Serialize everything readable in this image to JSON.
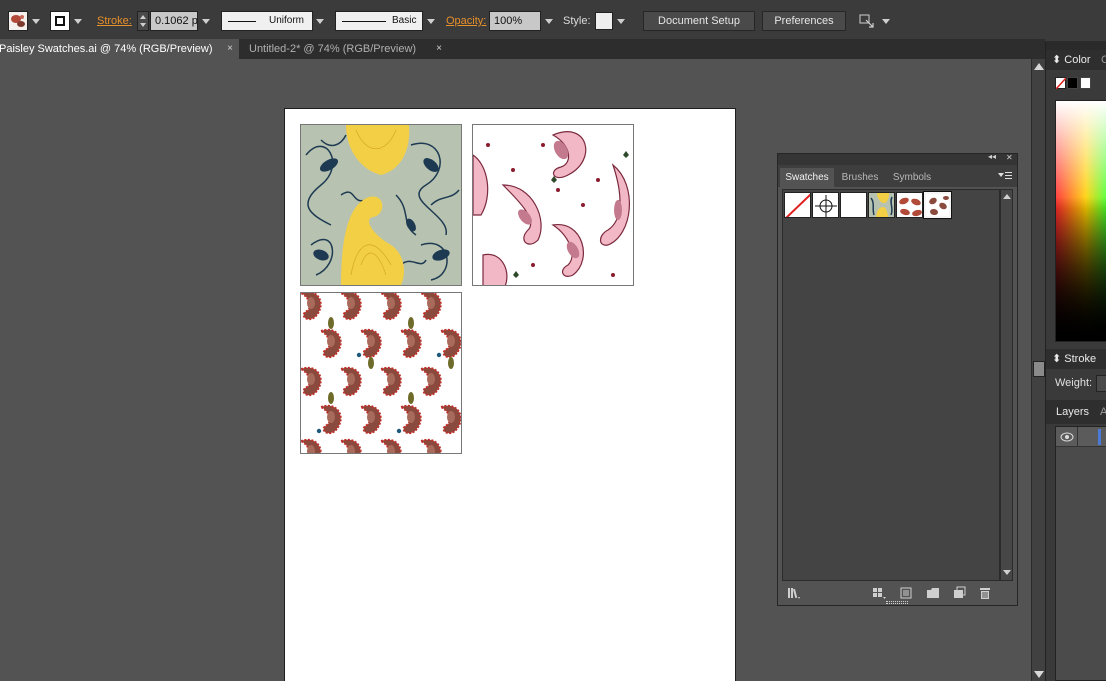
{
  "control_bar": {
    "stroke_label": "Stroke:",
    "stroke_weight": "0.1062 p",
    "profile": "Uniform",
    "brush": "Basic",
    "opacity_label": "Opacity:",
    "opacity_value": "100%",
    "style_label": "Style:",
    "document_setup": "Document Setup",
    "preferences": "Preferences"
  },
  "tabs": [
    {
      "label": "Paisley Swatches.ai @ 74% (RGB/Preview)",
      "close": "×"
    },
    {
      "label": "Untitled-2* @ 74% (RGB/Preview)",
      "close": "×"
    }
  ],
  "swatches_panel": {
    "tabs": [
      "Swatches",
      "Brushes",
      "Symbols"
    ],
    "collapse_glyph": "◂◂",
    "close_glyph": "✕",
    "swatches": [
      "None",
      "Registration",
      "White",
      "Pattern 1",
      "Pattern 2",
      "Pattern 3"
    ]
  },
  "right_dock": {
    "color_label": "Color",
    "color_tab2": "C",
    "stroke_label": "Stroke",
    "weight_label": "Weight:",
    "layers_label": "Layers",
    "layers_tab2": "A"
  },
  "colors": {
    "accent_orange": "#e8902a",
    "pattern1_bg": "#b7c3b0",
    "pattern1_ink": "#1e3a52",
    "pattern1_yellow": "#f3cf45",
    "pattern2_pink": "#f2b8c6",
    "pattern3_red": "#b24a3a"
  }
}
